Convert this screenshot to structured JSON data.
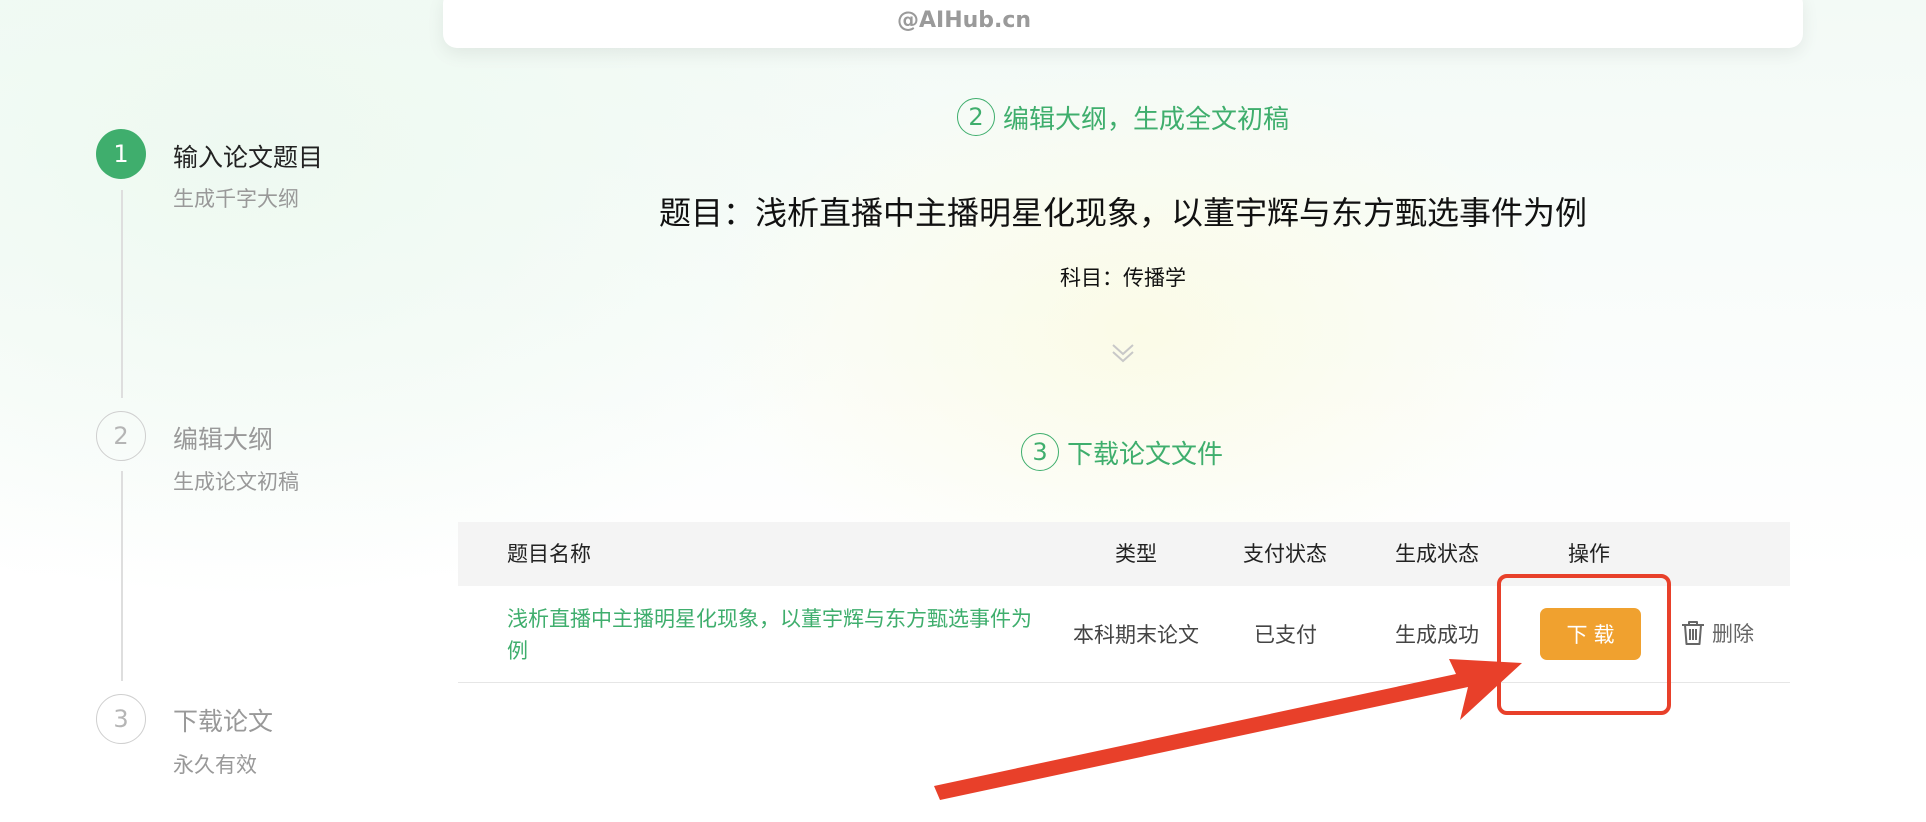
{
  "watermark": "@AIHub.cn",
  "steps": [
    {
      "number": "1",
      "title": "输入论文题目",
      "subtitle": "生成千字大纲"
    },
    {
      "number": "2",
      "title": "编辑大纲",
      "subtitle": "生成论文初稿"
    },
    {
      "number": "3",
      "title": "下载论文",
      "subtitle": "永久有效"
    }
  ],
  "section2": {
    "number": "2",
    "title": "编辑大纲，生成全文初稿"
  },
  "paper": {
    "title": "题目：浅析直播中主播明星化现象，以董宇辉与东方甄选事件为例",
    "subject": "科目：传播学"
  },
  "section3": {
    "number": "3",
    "title": "下载论文文件"
  },
  "table": {
    "headers": {
      "title": "题目名称",
      "type": "类型",
      "pay_status": "支付状态",
      "gen_status": "生成状态",
      "actions": "操作"
    },
    "rows": [
      {
        "title": "浅析直播中主播明星化现象，以董宇辉与东方甄选事件为例",
        "type": "本科期末论文",
        "pay_status": "已支付",
        "gen_status": "生成成功",
        "download_label": "下载",
        "delete_label": "删除"
      }
    ]
  },
  "colors": {
    "accent": "#3fae6d",
    "download": "#f0a12f",
    "annotation": "#e8402a"
  },
  "icons": {
    "delete": "trash-icon",
    "expand": "chevron-double-down-icon"
  }
}
